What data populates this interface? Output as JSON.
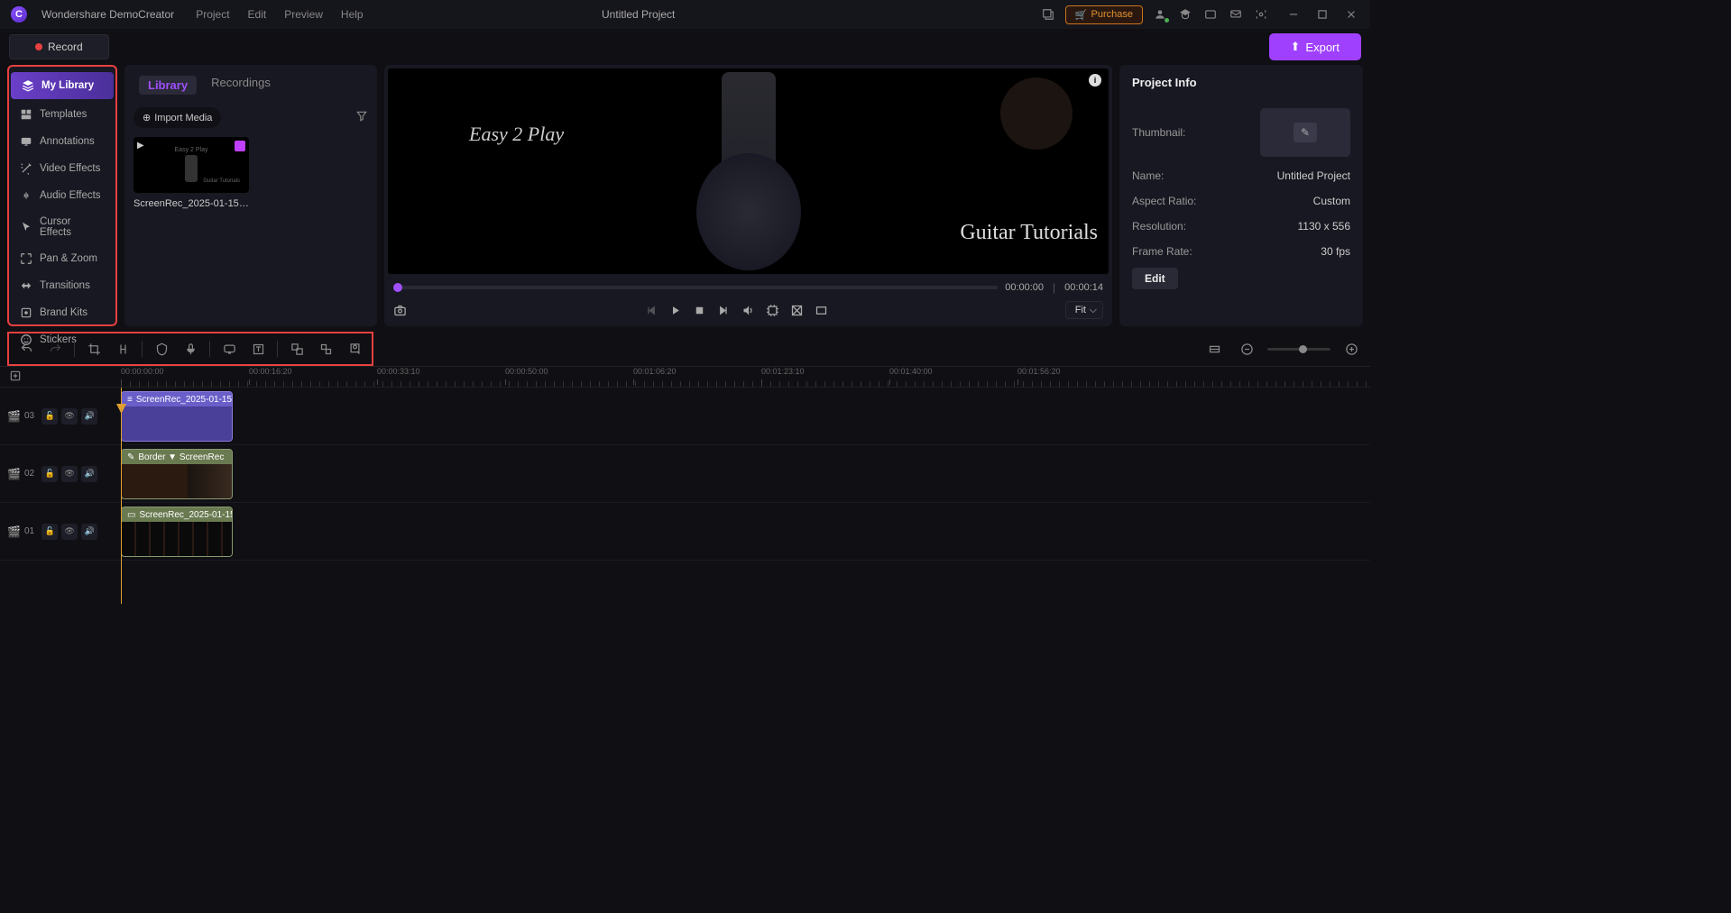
{
  "app": {
    "title": "Wondershare DemoCreator",
    "project_title": "Untitled Project"
  },
  "menu": [
    "Project",
    "Edit",
    "Preview",
    "Help"
  ],
  "titlebar_actions": {
    "purchase": "Purchase"
  },
  "toolbar": {
    "record": "Record",
    "export": "Export"
  },
  "sidebar": {
    "items": [
      {
        "label": "My Library",
        "icon": "layers"
      },
      {
        "label": "Templates",
        "icon": "template"
      },
      {
        "label": "Annotations",
        "icon": "annotate"
      },
      {
        "label": "Video Effects",
        "icon": "wand"
      },
      {
        "label": "Audio Effects",
        "icon": "audio"
      },
      {
        "label": "Cursor Effects",
        "icon": "cursor"
      },
      {
        "label": "Pan & Zoom",
        "icon": "panzoom"
      },
      {
        "label": "Transitions",
        "icon": "transition"
      },
      {
        "label": "Brand Kits",
        "icon": "brand"
      },
      {
        "label": "Stickers",
        "icon": "sticker"
      }
    ]
  },
  "library": {
    "tabs": [
      "Library",
      "Recordings"
    ],
    "import_label": "Import Media",
    "media": [
      {
        "name": "ScreenRec_2025-01-15 ..."
      }
    ]
  },
  "preview": {
    "text_left": "Easy 2 Play",
    "text_right": "Guitar Tutorials",
    "current_time": "00:00:00",
    "duration": "00:00:14",
    "fit": "Fit"
  },
  "props": {
    "title": "Project Info",
    "thumbnail_label": "Thumbnail:",
    "name_label": "Name:",
    "name_value": "Untitled Project",
    "aspect_label": "Aspect Ratio:",
    "aspect_value": "Custom",
    "resolution_label": "Resolution:",
    "resolution_value": "1130 x 556",
    "fps_label": "Frame Rate:",
    "fps_value": "30 fps",
    "edit_btn": "Edit"
  },
  "timeline": {
    "ruler": [
      "00:00:00:00",
      "00:00:16:20",
      "00:00:33:10",
      "00:00:50:00",
      "00:01:06:20",
      "00:01:23:10",
      "00:01:40:00",
      "00:01:56:20"
    ],
    "tracks": [
      {
        "num": "03",
        "clip_label": "ScreenRec_2025-01-15"
      },
      {
        "num": "02",
        "clip_label": "Border  ▼    ScreenRec"
      },
      {
        "num": "01",
        "clip_label": "ScreenRec_2025-01-15"
      }
    ]
  }
}
